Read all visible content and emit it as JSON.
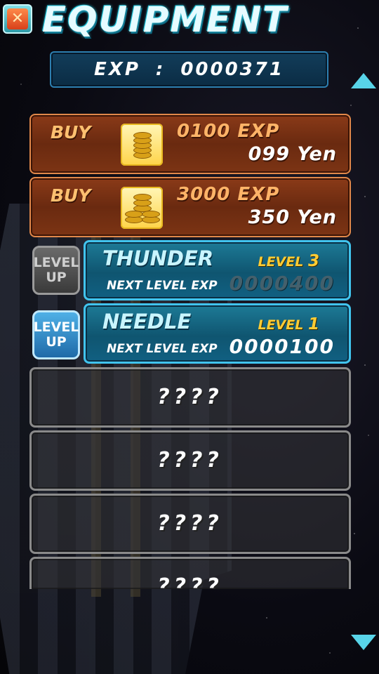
{
  "header": {
    "title": "EQUIPMENT",
    "close_icon": "crossed-swords-icon"
  },
  "exp": {
    "label": "EXP",
    "separator": ":",
    "value": "0000371"
  },
  "scroll": {
    "up_icon": "triangle-up-icon",
    "down_icon": "triangle-down-icon"
  },
  "shop": [
    {
      "buy_label": "BUY",
      "icon": "coin-stack-small-icon",
      "exp_amount": "0100 EXP",
      "price": "099 Yen"
    },
    {
      "buy_label": "BUY",
      "icon": "coin-pile-large-icon",
      "exp_amount": "3000 EXP",
      "price": "350 Yen"
    }
  ],
  "weapons": [
    {
      "button_line1": "LEVEL",
      "button_line2": "UP",
      "button_enabled": false,
      "name": "THUNDER",
      "level_label": "LEVEL",
      "level": "3",
      "next_label": "NEXT LEVEL EXP",
      "next_exp": "0000400"
    },
    {
      "button_line1": "LEVEL",
      "button_line2": "UP",
      "button_enabled": true,
      "name": "NEEDLE",
      "level_label": "LEVEL",
      "level": "1",
      "next_label": "NEXT LEVEL EXP",
      "next_exp": "0000100"
    }
  ],
  "locked": [
    {
      "text": "????"
    },
    {
      "text": "????"
    },
    {
      "text": "????"
    },
    {
      "text": "????"
    }
  ]
}
